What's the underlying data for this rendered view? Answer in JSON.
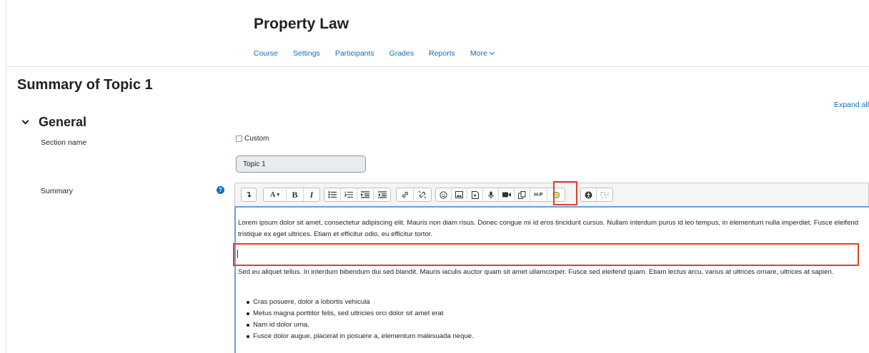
{
  "header": {
    "course_title": "Property Law",
    "nav": [
      "Course",
      "Settings",
      "Participants",
      "Grades",
      "Reports",
      "More"
    ]
  },
  "page": {
    "title": "Summary of Topic 1",
    "expand_all": "Expand all"
  },
  "section": {
    "title": "General",
    "section_name_label": "Section name",
    "custom_label": "Custom",
    "custom_checked": false,
    "topic_value": "Topic 1",
    "summary_label": "Summary",
    "help_glyph": "?"
  },
  "toolbar": {
    "icons": [
      "collapse-icon",
      "font-color-icon",
      "bold-icon",
      "italic-icon",
      "unordered-list-icon",
      "ordered-list-icon",
      "indent-icon",
      "outdent-icon",
      "link-icon",
      "unlink-icon",
      "emoji-icon",
      "image-icon",
      "media-icon",
      "record-audio-icon",
      "record-video-icon",
      "manage-files-icon",
      "h5p-icon",
      "plugin-icon",
      "accessibility-checker-icon",
      "screenreader-helper-icon"
    ],
    "highlight_color": "#e53e2a"
  },
  "editor": {
    "para1": "Lorem ipsum dolor sit amet, consectetur adipiscing elit. Mauris non diam risus. Donec congue mi id eros tincidunt cursus. Nullam interdum purus id leo tempus, in elementum nulla imperdiet. Fusce eleifend tristique ex eget ultrices. Etiam et efficitur odio, eu efficitur tortor.",
    "para2": "Sed eu aliquet tellus. In interdum bibendum dui sed blandit. Mauris iaculis auctor quam sit amet ullamcorper. Fusce sed eleifend quam. Etiam lectus arcu, varius at ultrices ornare, ultrices at sapien.",
    "bullets": [
      "Cras posuere, dolor a lobortis vehicula",
      "Metus magna porttitor felis, sed ultricies orci dolor sit amet erat",
      "Nam id dolor urna.",
      "Fusce dolor augue, placerat in posuere a, elementum malesuada neque."
    ]
  },
  "colors": {
    "link": "#0f6cbf",
    "focus_border": "#6a9edb"
  }
}
